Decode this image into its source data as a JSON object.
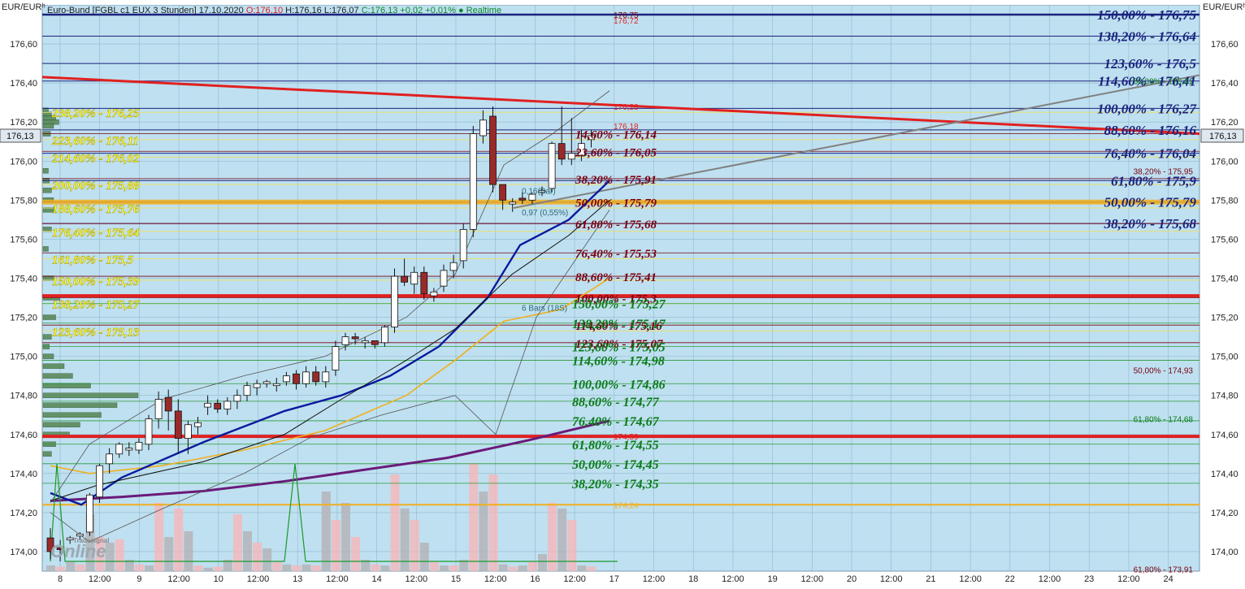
{
  "header": {
    "unit_left": "EUR/EURʰ",
    "unit_right": "EUR/EURʰ",
    "symbol": "Euro-Bund [FGBL c1 EUX 3 Stunden] 17.10.2020",
    "open": "O:176,10",
    "high": "H:176,16",
    "low": "L:176,07",
    "close": "C:176,13 +0,02 +0,01%",
    "realtime": "● Realtime",
    "last_price": "176,13"
  },
  "watermark": {
    "brand_small": "Tradesignal",
    "brand_big": "Online"
  },
  "colors": {
    "plot_bg": "#bfe0f0",
    "grid": "#8fb8d0",
    "navy": "#1a237e",
    "red_line": "#e02020",
    "yellow": "#ffff33",
    "dark_red": "#7a0010",
    "green": "#0a7a1a",
    "orange": "#f0b020",
    "purple": "#6a1a7a",
    "bull": "#ffffff",
    "bear": "#9a2a2a"
  },
  "chart_data": {
    "type": "candlestick",
    "ylim": [
      173.9,
      176.8
    ],
    "y_ticks": [
      "174,00",
      "174,20",
      "174,40",
      "174,60",
      "174,80",
      "175,00",
      "175,20",
      "175,40",
      "175,60",
      "175,80",
      "176,00",
      "176,20",
      "176,40",
      "176,60"
    ],
    "x_ticks": [
      "8",
      "12:00",
      "9",
      "12:00",
      "10",
      "12:00",
      "13",
      "12:00",
      "14",
      "12:00",
      "15",
      "12:00",
      "16",
      "12:00",
      "17",
      "12:00",
      "18",
      "12:00",
      "19",
      "12:00",
      "20",
      "12:00",
      "21",
      "12:00",
      "22",
      "12:00",
      "23",
      "12:00",
      "24"
    ],
    "candles": [
      [
        174.07,
        174.12,
        173.96,
        174.0
      ],
      [
        174.02,
        174.06,
        173.95,
        174.01
      ],
      [
        174.06,
        174.08,
        174.04,
        174.07
      ],
      [
        174.08,
        174.1,
        174.06,
        174.09
      ],
      [
        174.1,
        174.3,
        174.08,
        174.29
      ],
      [
        174.28,
        174.45,
        174.25,
        174.44
      ],
      [
        174.45,
        174.53,
        174.4,
        174.5
      ],
      [
        174.5,
        174.56,
        174.48,
        174.55
      ],
      [
        174.52,
        174.56,
        174.49,
        174.53
      ],
      [
        174.52,
        174.58,
        174.5,
        174.56
      ],
      [
        174.55,
        174.7,
        174.52,
        174.68
      ],
      [
        174.68,
        174.82,
        174.63,
        174.78
      ],
      [
        174.79,
        174.83,
        174.62,
        174.72
      ],
      [
        174.72,
        174.78,
        174.5,
        174.58
      ],
      [
        174.58,
        174.67,
        174.5,
        174.65
      ],
      [
        174.64,
        174.69,
        174.6,
        174.66
      ],
      [
        174.74,
        174.8,
        174.7,
        174.76
      ],
      [
        174.76,
        174.78,
        174.71,
        174.73
      ],
      [
        174.73,
        174.79,
        174.7,
        174.77
      ],
      [
        174.77,
        174.83,
        174.73,
        174.8
      ],
      [
        174.8,
        174.87,
        174.77,
        174.85
      ],
      [
        174.84,
        174.88,
        174.8,
        174.86
      ],
      [
        174.86,
        174.88,
        174.84,
        174.87
      ],
      [
        174.85,
        174.89,
        174.82,
        174.86
      ],
      [
        174.87,
        174.92,
        174.85,
        174.9
      ],
      [
        174.91,
        174.93,
        174.83,
        174.86
      ],
      [
        174.86,
        174.95,
        174.84,
        174.92
      ],
      [
        174.92,
        174.95,
        174.85,
        174.87
      ],
      [
        174.87,
        174.95,
        174.84,
        174.92
      ],
      [
        174.93,
        175.08,
        174.9,
        175.05
      ],
      [
        175.06,
        175.12,
        175.03,
        175.1
      ],
      [
        175.1,
        175.12,
        175.06,
        175.09
      ],
      [
        175.07,
        175.1,
        175.04,
        175.08
      ],
      [
        175.08,
        175.08,
        175.04,
        175.06
      ],
      [
        175.07,
        175.16,
        175.05,
        175.15
      ],
      [
        175.15,
        175.45,
        175.12,
        175.41
      ],
      [
        175.41,
        175.5,
        175.36,
        175.38
      ],
      [
        175.37,
        175.46,
        175.32,
        175.43
      ],
      [
        175.43,
        175.46,
        175.29,
        175.32
      ],
      [
        175.31,
        175.35,
        175.28,
        175.33
      ],
      [
        175.36,
        175.47,
        175.33,
        175.44
      ],
      [
        175.44,
        175.52,
        175.4,
        175.48
      ],
      [
        175.49,
        175.68,
        175.45,
        175.65
      ],
      [
        175.65,
        176.18,
        175.61,
        176.14
      ],
      [
        176.13,
        176.26,
        176.09,
        176.21
      ],
      [
        176.23,
        176.28,
        175.84,
        175.88
      ],
      [
        175.88,
        175.88,
        175.75,
        175.8
      ],
      [
        175.78,
        175.81,
        175.74,
        175.79
      ],
      [
        175.81,
        175.84,
        175.78,
        175.8
      ],
      [
        175.8,
        175.84,
        175.78,
        175.83
      ],
      [
        175.84,
        175.87,
        175.82,
        175.85
      ],
      [
        175.86,
        176.1,
        175.84,
        176.09
      ],
      [
        176.09,
        176.28,
        175.98,
        176.01
      ],
      [
        176.01,
        176.22,
        175.98,
        176.04
      ],
      [
        176.03,
        176.16,
        176.0,
        176.09
      ],
      [
        176.11,
        176.16,
        176.07,
        176.13
      ]
    ],
    "volume_scale_max": 1.0,
    "volume": [
      0.05,
      0.04,
      0.08,
      0.06,
      0.5,
      0.3,
      0.25,
      0.28,
      0.1,
      0.06,
      0.05,
      0.6,
      0.3,
      0.55,
      0.35,
      0.05,
      0.03,
      0.04,
      0.1,
      0.5,
      0.35,
      0.25,
      0.2,
      0.08,
      0.06,
      0.05,
      0.06,
      0.05,
      0.7,
      0.45,
      0.6,
      0.3,
      0.1,
      0.06,
      0.05,
      0.85,
      0.55,
      0.45,
      0.25,
      0.08,
      0.05,
      0.05,
      0.1,
      0.95,
      0.7,
      0.85,
      0.06,
      0.04,
      0.05,
      0.08,
      0.15,
      0.6,
      0.55,
      0.45,
      0.05,
      0.04
    ],
    "volume_profile": [
      [
        176.26,
        0.05
      ],
      [
        176.24,
        0.08
      ],
      [
        176.22,
        0.12
      ],
      [
        176.2,
        0.15
      ],
      [
        176.18,
        0.1
      ],
      [
        176.14,
        0.07
      ],
      [
        175.95,
        0.05
      ],
      [
        175.9,
        0.06
      ],
      [
        175.85,
        0.08
      ],
      [
        175.8,
        0.1
      ],
      [
        175.75,
        0.12
      ],
      [
        175.65,
        0.08
      ],
      [
        175.55,
        0.05
      ],
      [
        175.4,
        0.1
      ],
      [
        175.3,
        0.16
      ],
      [
        175.2,
        0.12
      ],
      [
        175.1,
        0.08
      ],
      [
        175.05,
        0.06
      ],
      [
        175.0,
        0.1
      ],
      [
        174.95,
        0.2
      ],
      [
        174.9,
        0.28
      ],
      [
        174.85,
        0.45
      ],
      [
        174.8,
        0.9
      ],
      [
        174.75,
        0.7
      ],
      [
        174.7,
        0.55
      ],
      [
        174.65,
        0.35
      ],
      [
        174.6,
        0.25
      ],
      [
        174.55,
        0.12
      ],
      [
        174.5,
        0.08
      ]
    ],
    "navy_lines": [
      176.75,
      176.64,
      176.5,
      176.41,
      176.27,
      176.16,
      176.04,
      175.9,
      175.79,
      175.68
    ],
    "navy_labels": [
      "150,00% - 176,75",
      "138,20% - 176,64",
      "123,60% - 176,5",
      "114,60% - 176,41",
      "100,00% - 176,27",
      "88,60% - 176,16",
      "76,40% - 176,04",
      "61,80% - 175,9",
      "50,00% - 175,79",
      "38,20% - 175,68"
    ],
    "yellow_lines": [
      176.25,
      176.11,
      176.02,
      175.88,
      175.76,
      175.64,
      175.5,
      175.39,
      175.27,
      175.13
    ],
    "yellow_labels": [
      "238,20% - 176,25",
      "223,60% - 176,11",
      "214,60% - 176,02",
      "200,00% - 175,88",
      "188,60% - 175,76",
      "176,40% - 175,64",
      "161,80% - 175,5",
      "150,00% - 175,39",
      "138,20% - 175,27",
      "123,60% - 175,13"
    ],
    "darkred_lines": [
      176.14,
      176.05,
      175.91,
      175.79,
      175.68,
      175.53,
      175.41,
      175.3,
      175.16,
      175.07
    ],
    "darkred_labels": [
      "14,60% - 176,14",
      "23,60% - 176,05",
      "38,20% - 175,91",
      "50,00% - 175,79",
      "61,80% - 175,68",
      "76,40% - 175,53",
      "88,60% - 175,41",
      "100,00% - 175,3",
      "114,60% - 175,16",
      "123,60% - 175,07"
    ],
    "green_lines": [
      175.27,
      175.17,
      175.05,
      174.98,
      174.86,
      174.77,
      174.67,
      174.55,
      174.45,
      174.35
    ],
    "green_labels": [
      "150,00% - 175,27",
      "138,20% - 175,17",
      "123,60% - 175,05",
      "114,60% - 174,98",
      "100,00% - 174,86",
      "88,60% - 174,77",
      "76,40% - 174,67",
      "61,80% - 174,55",
      "50,00% - 174,45",
      "38,20% - 174,35"
    ],
    "right_small": [
      {
        "price": 175.95,
        "text": "38,20% - 175,95",
        "color": "#7a0010"
      },
      {
        "price": 174.93,
        "text": "50,00% - 174,93",
        "color": "#7a0010"
      },
      {
        "price": 174.68,
        "text": "61,80% - 174,68",
        "color": "#0a7a1a"
      },
      {
        "price": 176.41,
        "text": "50,00% - 176,41",
        "color": "#0a7a1a"
      },
      {
        "price": 173.91,
        "text": "61,80% - 173,91",
        "color": "#7a0010"
      }
    ],
    "price_labels": [
      {
        "price": 176.75,
        "text": "176,75",
        "color": "#7a0010"
      },
      {
        "price": 176.72,
        "text": "176,72",
        "color": "#e02020"
      },
      {
        "price": 176.28,
        "text": "176,28",
        "color": "#e02020"
      },
      {
        "price": 176.18,
        "text": "176,18",
        "color": "#e02020"
      },
      {
        "price": 174.59,
        "text": "174,59",
        "color": "#e02020"
      },
      {
        "price": 174.24,
        "text": "174,24",
        "color": "#f0b020"
      }
    ],
    "annotations": [
      {
        "price": 175.85,
        "text": "0,16(Bar)"
      },
      {
        "price": 175.74,
        "text": "0,97 (0,55%)"
      },
      {
        "price": 175.25,
        "text": "6 Bars (18S)"
      }
    ],
    "red_horizontal": [
      175.31,
      174.59
    ],
    "orange_horizontal": 174.24
  }
}
